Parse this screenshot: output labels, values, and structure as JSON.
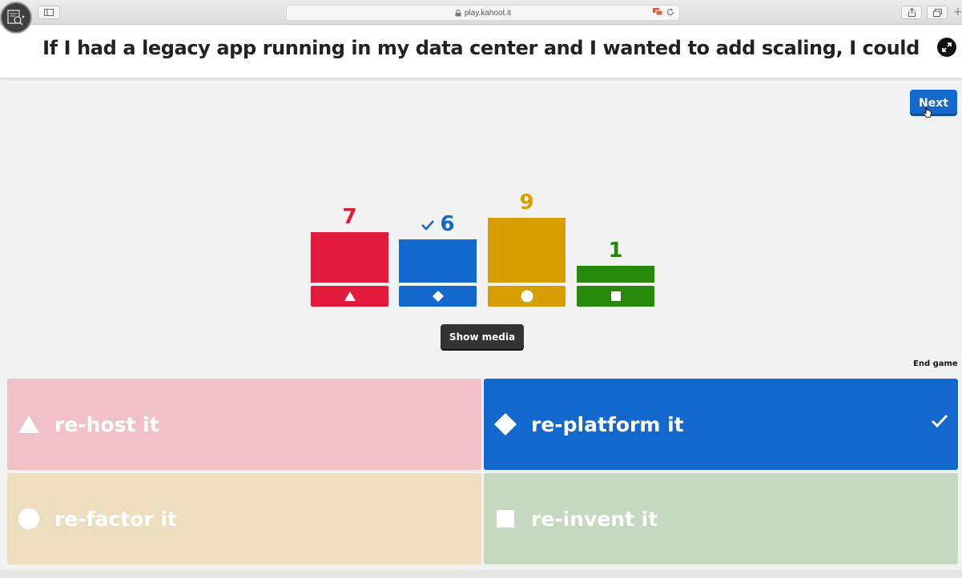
{
  "browser": {
    "url": "play.kahoot.it"
  },
  "question": {
    "text": "If I had a legacy app running in my data center and I wanted to add scaling, I could"
  },
  "controls": {
    "next_label": "Next",
    "show_media_label": "Show media",
    "end_game_label": "End game"
  },
  "results": [
    {
      "count": "7",
      "value": 7,
      "color": "#e21b3c",
      "shape": "triangle-icon",
      "correct": false
    },
    {
      "count": "6",
      "value": 6,
      "color": "#1368ce",
      "shape": "diamond-icon",
      "correct": true
    },
    {
      "count": "9",
      "value": 9,
      "color": "#d89e00",
      "shape": "circle-icon",
      "correct": false
    },
    {
      "count": "1",
      "value": 1,
      "color": "#26890c",
      "shape": "square-icon",
      "correct": false
    }
  ],
  "answers": [
    {
      "label": "re-host it",
      "shape": "triangle-icon",
      "bg": "#f2c1c8",
      "correct": false
    },
    {
      "label": "re-platform it",
      "shape": "diamond-icon",
      "bg": "#1368ce",
      "correct": true
    },
    {
      "label": "re-factor it",
      "shape": "circle-icon",
      "bg": "#eedec0",
      "correct": false
    },
    {
      "label": "re-invent it",
      "shape": "square-icon",
      "bg": "#c5d9c0",
      "correct": false
    }
  ]
}
